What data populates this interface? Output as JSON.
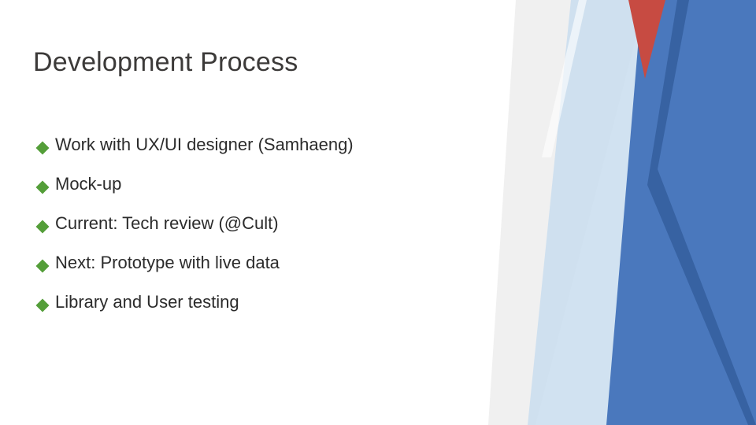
{
  "title": "Development Process",
  "bullets": [
    {
      "text": "Work with UX/UI designer (Samhaeng)"
    },
    {
      "text": "Mock-up"
    },
    {
      "text": "Current: Tech review (@Cult)"
    },
    {
      "text": "Next: Prototype with live data"
    },
    {
      "text": "Library and User testing"
    }
  ],
  "colors": {
    "accent_bullet": "#549e39",
    "facet_blue": "#4a78bd",
    "facet_red": "#c74b42",
    "facet_lightblue": "#b6cfe6",
    "facet_gray": "#e6e6e6"
  }
}
